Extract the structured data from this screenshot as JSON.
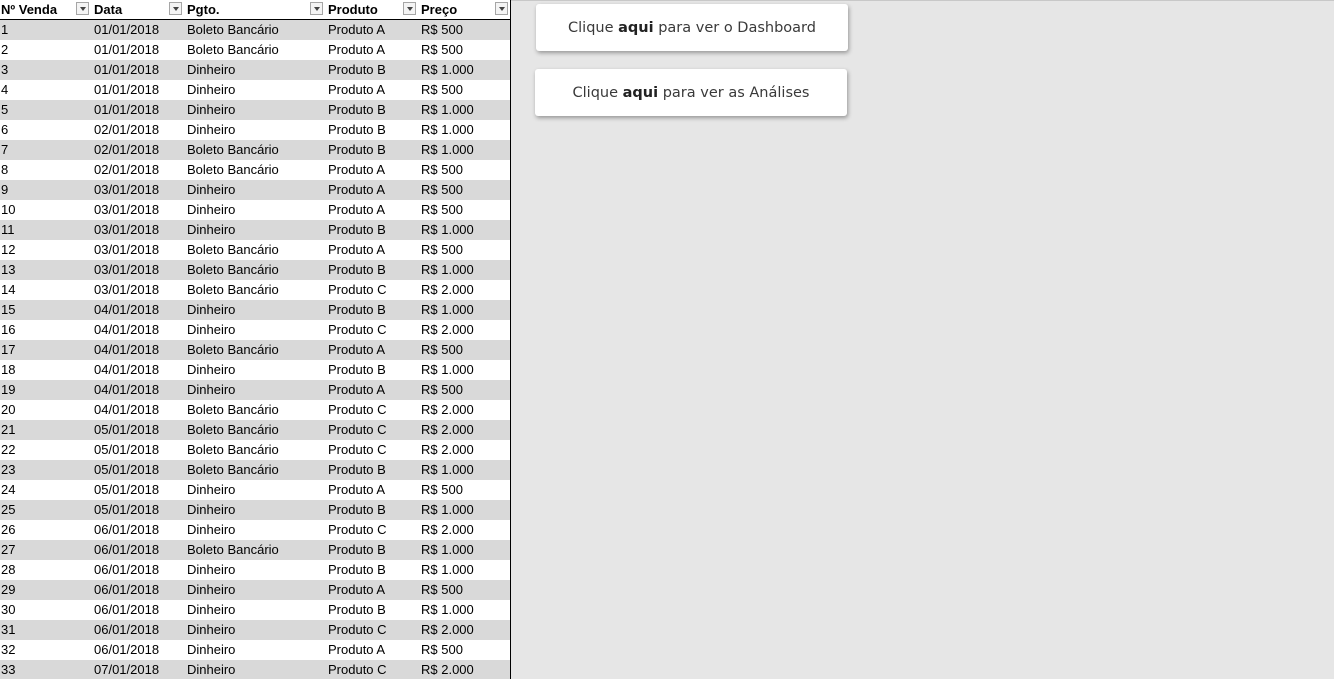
{
  "table": {
    "headers": [
      "Nº Venda",
      "Data",
      "Pgto.",
      "Produto",
      "Preço"
    ],
    "rows": [
      [
        "1",
        "01/01/2018",
        "Boleto Bancário",
        "Produto A",
        "R$ 500"
      ],
      [
        "2",
        "01/01/2018",
        "Boleto Bancário",
        "Produto A",
        "R$ 500"
      ],
      [
        "3",
        "01/01/2018",
        "Dinheiro",
        "Produto B",
        "R$ 1.000"
      ],
      [
        "4",
        "01/01/2018",
        "Dinheiro",
        "Produto A",
        "R$ 500"
      ],
      [
        "5",
        "01/01/2018",
        "Dinheiro",
        "Produto B",
        "R$ 1.000"
      ],
      [
        "6",
        "02/01/2018",
        "Dinheiro",
        "Produto B",
        "R$ 1.000"
      ],
      [
        "7",
        "02/01/2018",
        "Boleto Bancário",
        "Produto B",
        "R$ 1.000"
      ],
      [
        "8",
        "02/01/2018",
        "Boleto Bancário",
        "Produto A",
        "R$ 500"
      ],
      [
        "9",
        "03/01/2018",
        "Dinheiro",
        "Produto A",
        "R$ 500"
      ],
      [
        "10",
        "03/01/2018",
        "Dinheiro",
        "Produto A",
        "R$ 500"
      ],
      [
        "11",
        "03/01/2018",
        "Dinheiro",
        "Produto B",
        "R$ 1.000"
      ],
      [
        "12",
        "03/01/2018",
        "Boleto Bancário",
        "Produto A",
        "R$ 500"
      ],
      [
        "13",
        "03/01/2018",
        "Boleto Bancário",
        "Produto B",
        "R$ 1.000"
      ],
      [
        "14",
        "03/01/2018",
        "Boleto Bancário",
        "Produto C",
        "R$ 2.000"
      ],
      [
        "15",
        "04/01/2018",
        "Dinheiro",
        "Produto B",
        "R$ 1.000"
      ],
      [
        "16",
        "04/01/2018",
        "Dinheiro",
        "Produto C",
        "R$ 2.000"
      ],
      [
        "17",
        "04/01/2018",
        "Boleto Bancário",
        "Produto A",
        "R$ 500"
      ],
      [
        "18",
        "04/01/2018",
        "Dinheiro",
        "Produto B",
        "R$ 1.000"
      ],
      [
        "19",
        "04/01/2018",
        "Dinheiro",
        "Produto A",
        "R$ 500"
      ],
      [
        "20",
        "04/01/2018",
        "Boleto Bancário",
        "Produto C",
        "R$ 2.000"
      ],
      [
        "21",
        "05/01/2018",
        "Boleto Bancário",
        "Produto C",
        "R$ 2.000"
      ],
      [
        "22",
        "05/01/2018",
        "Boleto Bancário",
        "Produto C",
        "R$ 2.000"
      ],
      [
        "23",
        "05/01/2018",
        "Boleto Bancário",
        "Produto B",
        "R$ 1.000"
      ],
      [
        "24",
        "05/01/2018",
        "Dinheiro",
        "Produto A",
        "R$ 500"
      ],
      [
        "25",
        "05/01/2018",
        "Dinheiro",
        "Produto B",
        "R$ 1.000"
      ],
      [
        "26",
        "06/01/2018",
        "Dinheiro",
        "Produto C",
        "R$ 2.000"
      ],
      [
        "27",
        "06/01/2018",
        "Boleto Bancário",
        "Produto B",
        "R$ 1.000"
      ],
      [
        "28",
        "06/01/2018",
        "Dinheiro",
        "Produto B",
        "R$ 1.000"
      ],
      [
        "29",
        "06/01/2018",
        "Dinheiro",
        "Produto A",
        "R$ 500"
      ],
      [
        "30",
        "06/01/2018",
        "Dinheiro",
        "Produto B",
        "R$ 1.000"
      ],
      [
        "31",
        "06/01/2018",
        "Dinheiro",
        "Produto C",
        "R$ 2.000"
      ],
      [
        "32",
        "06/01/2018",
        "Dinheiro",
        "Produto A",
        "R$ 500"
      ],
      [
        "33",
        "07/01/2018",
        "Dinheiro",
        "Produto C",
        "R$ 2.000"
      ]
    ]
  },
  "buttons": {
    "dashboard": {
      "pre": "Clique ",
      "bold": "aqui",
      "post": " para ver o Dashboard"
    },
    "analises": {
      "pre": "Clique ",
      "bold": "aqui",
      "post": " para ver as Análises"
    }
  },
  "colors": {
    "row_band": "#d9d9d9",
    "background": "#e6e6e6"
  },
  "icons": {
    "filter": "filter-dropdown-icon"
  }
}
